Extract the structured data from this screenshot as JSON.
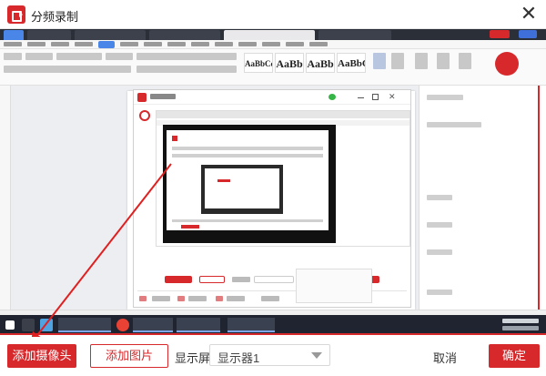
{
  "window": {
    "title": "分频录制",
    "close_icon": "close-icon"
  },
  "bottom": {
    "add_camera_label": "添加摄像头",
    "add_image_label": "添加图片",
    "screen_label": "显示屏:",
    "screen_value": "显示器1",
    "cancel_label": "取消",
    "ok_label": "确定"
  },
  "ribbon": {
    "styles": [
      "AaBbCcDd",
      "AaBb",
      "AaBb",
      "AaBbC",
      "AaBbCcI"
    ]
  },
  "colors": {
    "accent": "#d7282c",
    "taskbar": "#1f2430",
    "wps_tabbar": "#2b2f38"
  }
}
